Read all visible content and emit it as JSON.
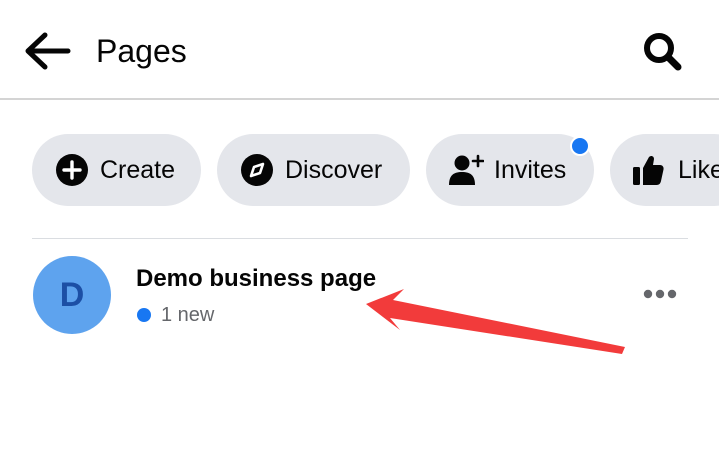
{
  "header": {
    "title": "Pages",
    "back_icon": "arrow-left-icon",
    "search_icon": "search-icon"
  },
  "chips": [
    {
      "label": "Create",
      "icon": "plus-circle-icon"
    },
    {
      "label": "Discover",
      "icon": "compass-icon"
    },
    {
      "label": "Invites",
      "icon": "add-person-icon",
      "has_notification": true
    },
    {
      "label": "Likes",
      "icon": "thumbs-up-icon"
    }
  ],
  "pages": [
    {
      "avatar_letter": "D",
      "name": "Demo business page",
      "status": "1 new",
      "more_icon": "more-horizontal-icon"
    }
  ],
  "colors": {
    "accent": "#1877f2",
    "chip_bg": "#e4e6eb",
    "avatar_bg": "#5ea3ee",
    "annotation_arrow": "#f23b3b"
  }
}
